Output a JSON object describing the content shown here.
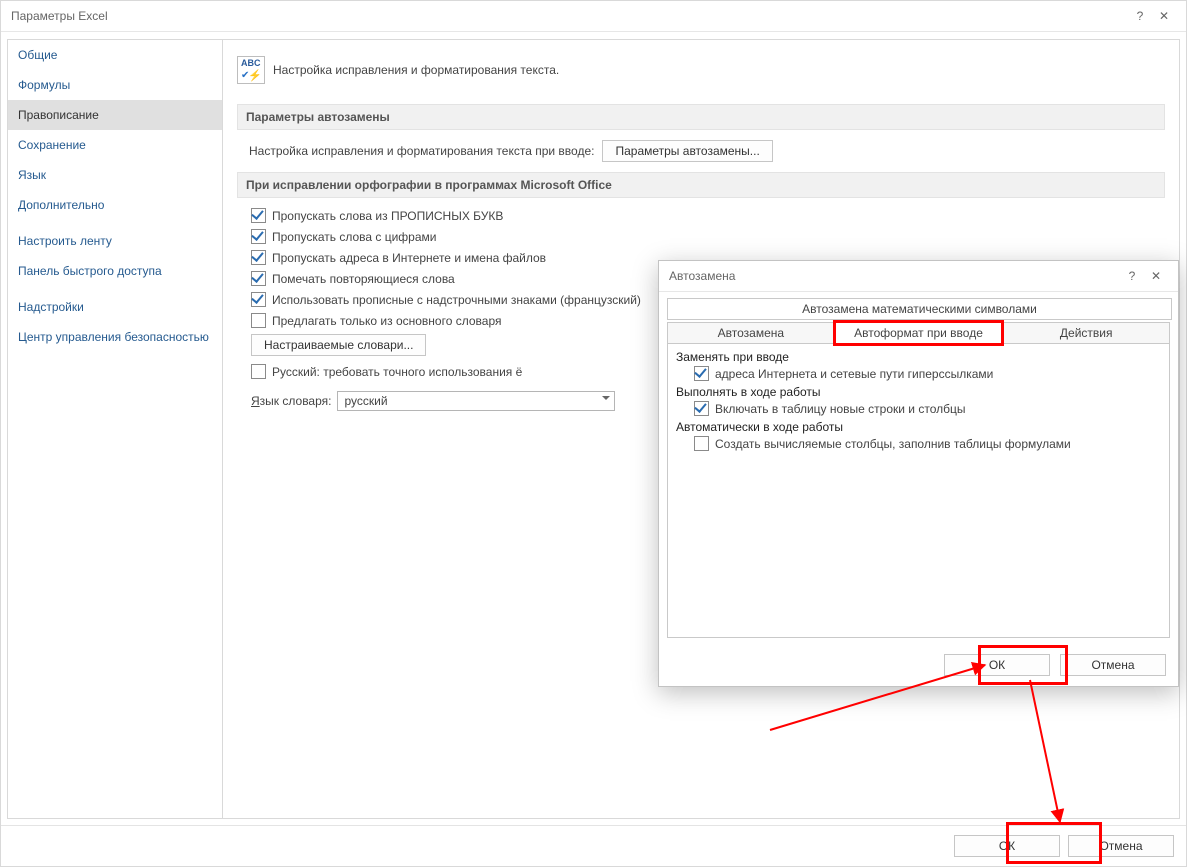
{
  "window": {
    "title": "Параметры Excel",
    "help_icon": "?",
    "close_icon": "✕"
  },
  "sidebar": {
    "items": [
      {
        "label": "Общие"
      },
      {
        "label": "Формулы"
      },
      {
        "label": "Правописание",
        "selected": true
      },
      {
        "label": "Сохранение"
      },
      {
        "label": "Язык"
      },
      {
        "label": "Дополнительно"
      },
      {
        "label": "Настроить ленту"
      },
      {
        "label": "Панель быстрого доступа"
      },
      {
        "label": "Надстройки"
      },
      {
        "label": "Центр управления безопасностью"
      }
    ]
  },
  "main": {
    "header_text": "Настройка исправления и форматирования текста.",
    "autoreplace_section": "Параметры автозамены",
    "autoreplace_label": "Настройка исправления и форматирования текста при вводе:",
    "autoreplace_button": "Параметры автозамены...",
    "spellcheck_section": "При исправлении орфографии в программах Microsoft Office",
    "checks": [
      {
        "label": "Пропускать слова из ПРОПИСНЫХ БУКВ",
        "checked": true
      },
      {
        "label": "Пропускать слова с цифрами",
        "checked": true
      },
      {
        "label": "Пропускать адреса в Интернете и имена файлов",
        "checked": true
      },
      {
        "label": "Помечать повторяющиеся слова",
        "checked": true
      },
      {
        "label": "Использовать прописные с надстрочными знаками (французский)",
        "checked": true
      },
      {
        "label": "Предлагать только из основного словаря",
        "checked": false
      }
    ],
    "custom_dict_button": "Настраиваемые словари...",
    "russian_check": {
      "label": "Русский: требовать точного использования ё",
      "checked": false
    },
    "dict_lang_label_pre": "Я",
    "dict_lang_label_post": "зык словаря:",
    "dict_lang_value": "русский",
    "ok": "ОК",
    "cancel": "Отмена"
  },
  "dlg2": {
    "title": "Автозамена",
    "help_icon": "?",
    "close_icon": "✕",
    "top_tab": "Автозамена математическими символами",
    "tabs": [
      {
        "label": "Автозамена"
      },
      {
        "label": "Автоформат при вводе",
        "active": true,
        "highlight": true
      },
      {
        "label": "Действия"
      }
    ],
    "group_replace": "Заменять при вводе",
    "chk_hyperlinks": {
      "label": "адреса Интернета и сетевые пути гиперссылками",
      "checked": true
    },
    "group_apply": "Выполнять в ходе работы",
    "chk_table": {
      "label": "Включать в таблицу новые строки и столбцы",
      "checked": true
    },
    "group_auto": "Автоматически в ходе работы",
    "chk_formula_cols": {
      "label": "Создать вычисляемые столбцы, заполнив таблицы формулами",
      "checked": false
    },
    "ok": "ОК",
    "cancel": "Отмена"
  }
}
